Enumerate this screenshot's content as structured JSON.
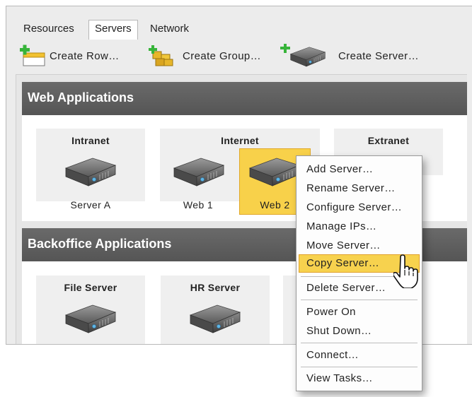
{
  "tabs": [
    {
      "label": "Resources",
      "active": false
    },
    {
      "label": "Servers",
      "active": true
    },
    {
      "label": "Network",
      "active": false
    }
  ],
  "toolbar": {
    "create_row": "Create Row…",
    "create_group": "Create Group…",
    "create_server": "Create Server…"
  },
  "rows": [
    {
      "title": "Web Applications",
      "groups": [
        {
          "title": "Intranet",
          "servers": [
            "Server A"
          ]
        },
        {
          "title": "Internet",
          "servers": [
            "Web 1",
            "Web 2"
          ]
        },
        {
          "title": "Extranet",
          "servers": []
        }
      ]
    },
    {
      "title": "Backoffice Applications",
      "groups": [
        {
          "title": "File Server",
          "servers": []
        },
        {
          "title": "HR Server",
          "servers": []
        }
      ]
    }
  ],
  "context_menu": {
    "items": [
      "Add Server…",
      "Rename Server…",
      "Configure Server…",
      "Manage IPs…",
      "Move Server…",
      "Copy Server…",
      "Delete Server…",
      "Power On",
      "Shut Down…",
      "Connect…",
      "View Tasks…"
    ],
    "highlighted": "Copy Server…"
  },
  "colors": {
    "selection": "#f8d14a",
    "header": "#5e5e5e"
  },
  "icons": [
    "plus-icon",
    "row-icon",
    "group-icon",
    "server-icon",
    "hand-cursor-icon"
  ]
}
